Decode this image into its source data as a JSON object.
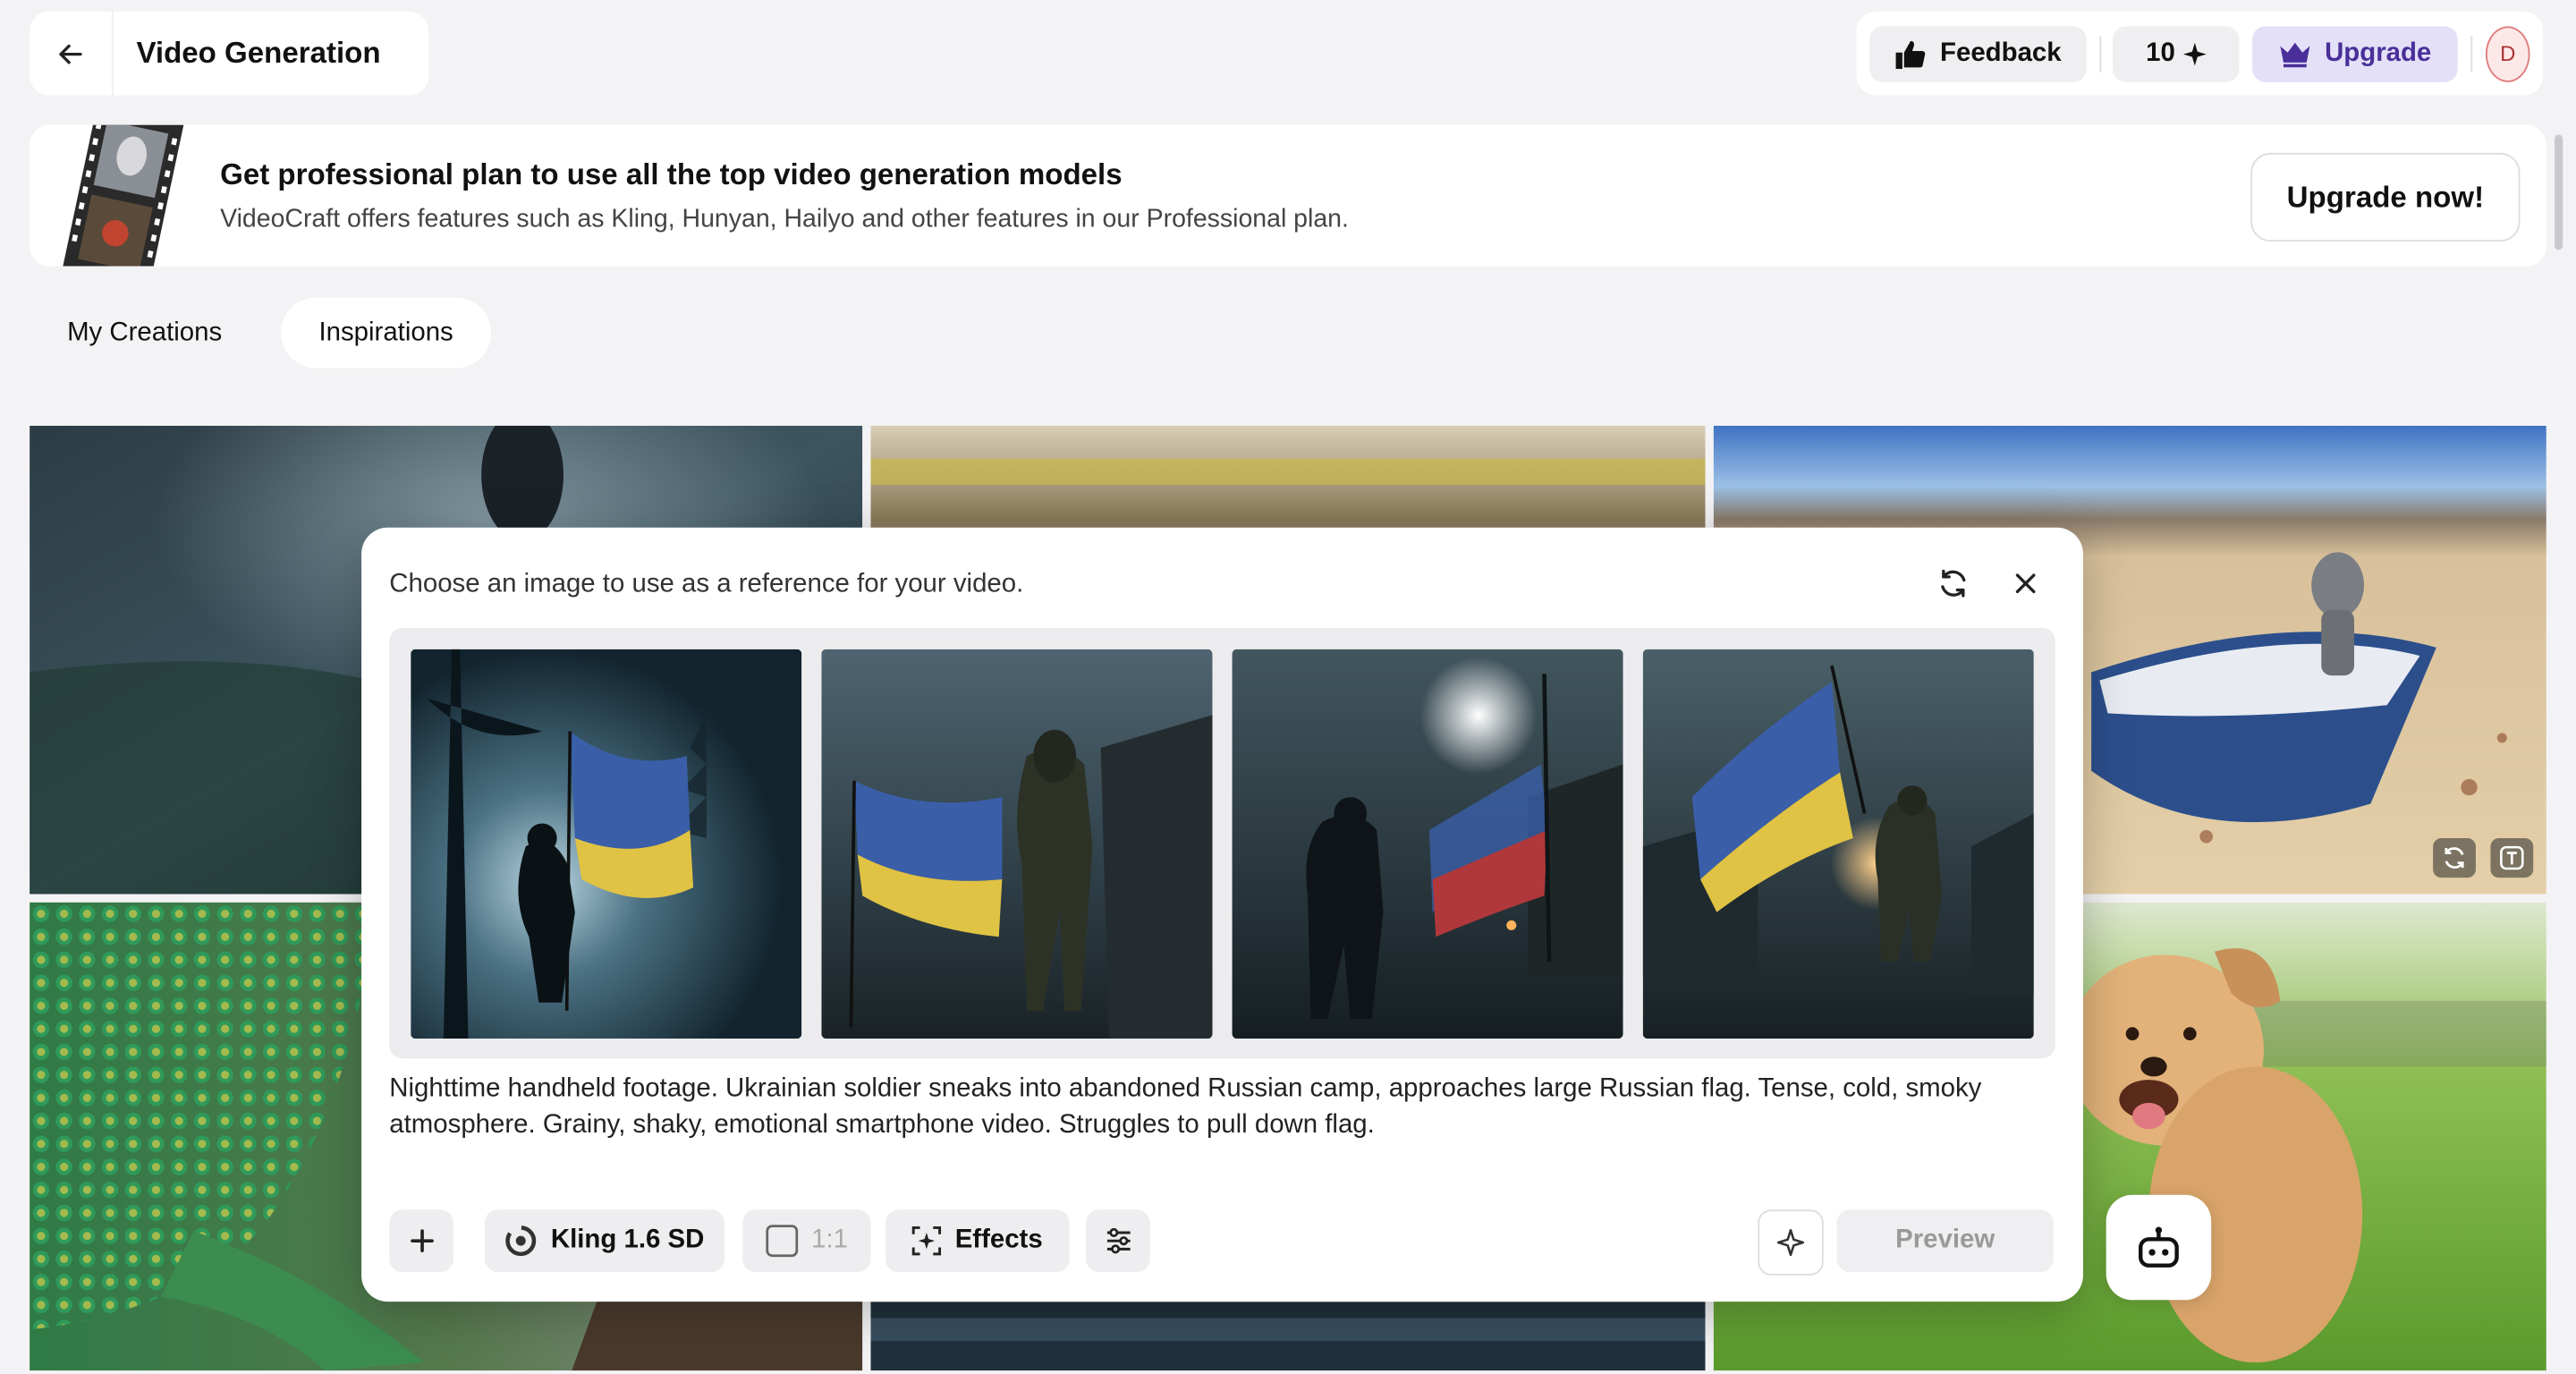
{
  "header": {
    "back_icon": "arrow-left-icon",
    "title": "Video Generation",
    "feedback_label": "Feedback",
    "credits": "10",
    "upgrade_label": "Upgrade",
    "avatar_initial": "D"
  },
  "banner": {
    "title": "Get professional plan to use all the top video generation models",
    "subtitle": "VideoCraft offers features such as Kling, Hunyan, Hailyo and other features in our Professional plan.",
    "cta_label": "Upgrade now!"
  },
  "tabs": [
    {
      "label": "My Creations",
      "active": false
    },
    {
      "label": "Inspirations",
      "active": true
    }
  ],
  "modal": {
    "heading": "Choose an image to use as a reference for your video.",
    "prompt": "Nighttime handheld footage. Ukrainian soldier sneaks into abandoned Russian camp, approaches large Russian flag. Tense, cold, smoky atmosphere. Grainy, shaky, emotional smartphone video. Struggles to pull down flag.",
    "model_label": "Kling 1.6 SD",
    "ratio_label": "1:1",
    "effects_label": "Effects",
    "preview_label": "Preview"
  },
  "colors": {
    "accent_purple": "#4a2f9a",
    "upgrade_bg": "#e4e0f7",
    "ukraine_blue": "#3a5fa8",
    "ukraine_yellow": "#e0c244"
  }
}
